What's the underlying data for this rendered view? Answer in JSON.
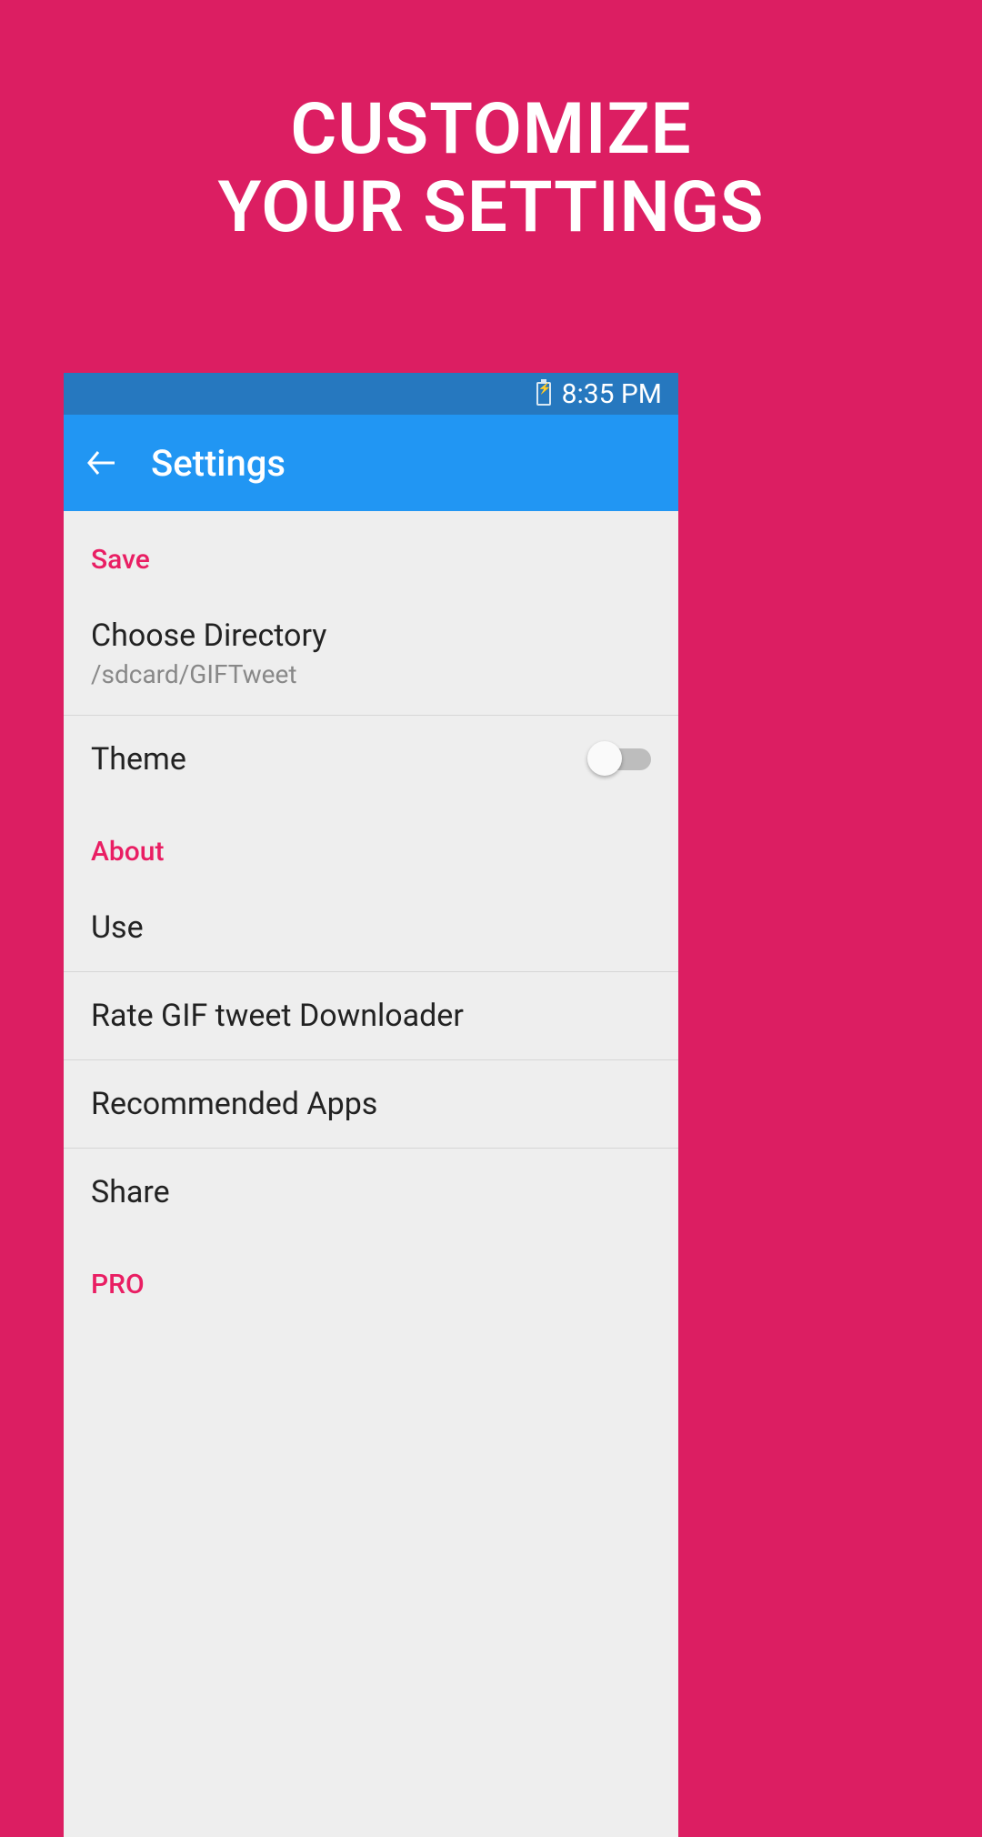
{
  "promo": {
    "line1": "CUSTOMIZE",
    "line2": "YOUR SETTINGS"
  },
  "status_bar": {
    "time": "8:35 PM"
  },
  "app_bar": {
    "title": "Settings"
  },
  "sections": {
    "save": {
      "header": "Save",
      "choose_directory": {
        "title": "Choose Directory",
        "subtitle": "/sdcard/GIFTweet"
      },
      "theme": {
        "title": "Theme",
        "toggle_on": false
      }
    },
    "about": {
      "header": "About",
      "use": "Use",
      "rate": "Rate GIF tweet Downloader",
      "recommended": "Recommended Apps",
      "share": "Share"
    },
    "pro": {
      "header": "PRO"
    }
  }
}
